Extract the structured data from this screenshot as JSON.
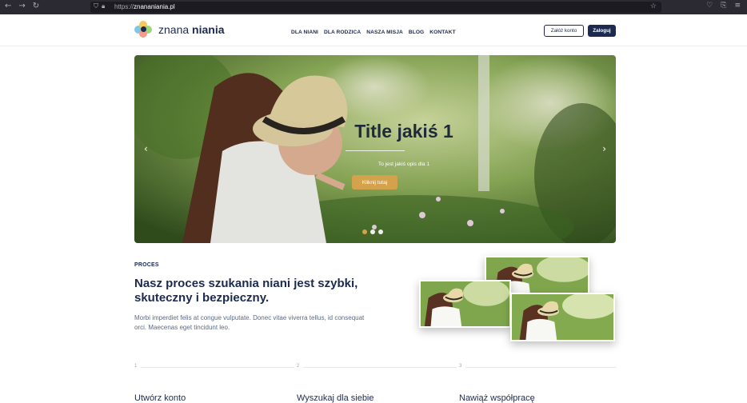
{
  "browser": {
    "url_scheme": "https://",
    "url_host": "znananiania.pl",
    "nav_icons": [
      "back-arrow-icon",
      "forward-arrow-icon",
      "reload-icon"
    ]
  },
  "header": {
    "logo_light": "znana",
    "logo_bold": "niania",
    "nav": [
      "DLA NIANI",
      "DLA RODZICA",
      "NASZA MISJA",
      "BLOG",
      "KONTAKT"
    ],
    "register_label": "Załóż konto",
    "login_label": "Zaloguj"
  },
  "hero": {
    "title": "Title jakiś 1",
    "description": "To jest jakiś opis dla 1",
    "cta_label": "Kliknij tutaj",
    "slide_count": 3,
    "active_slide": 1,
    "accent": "#d4a24c"
  },
  "process": {
    "kicker": "PROCES",
    "heading": "Nasz proces szukania niani jest szybki, skuteczny i bezpieczny.",
    "text": "Morbi imperdiet felis at congue vulputate. Donec vitae viverra tellus, id consequat orci. Maecenas eget tincidunt leo."
  },
  "steps": [
    {
      "num": "1",
      "title": "Utwórz konto"
    },
    {
      "num": "2",
      "title": "Wyszukaj dla siebie"
    },
    {
      "num": "3",
      "title": "Nawiąż współpracę"
    }
  ],
  "colors": {
    "navy": "#1b2a4e",
    "gold": "#d4a24c",
    "text_muted": "#5a6b86"
  }
}
